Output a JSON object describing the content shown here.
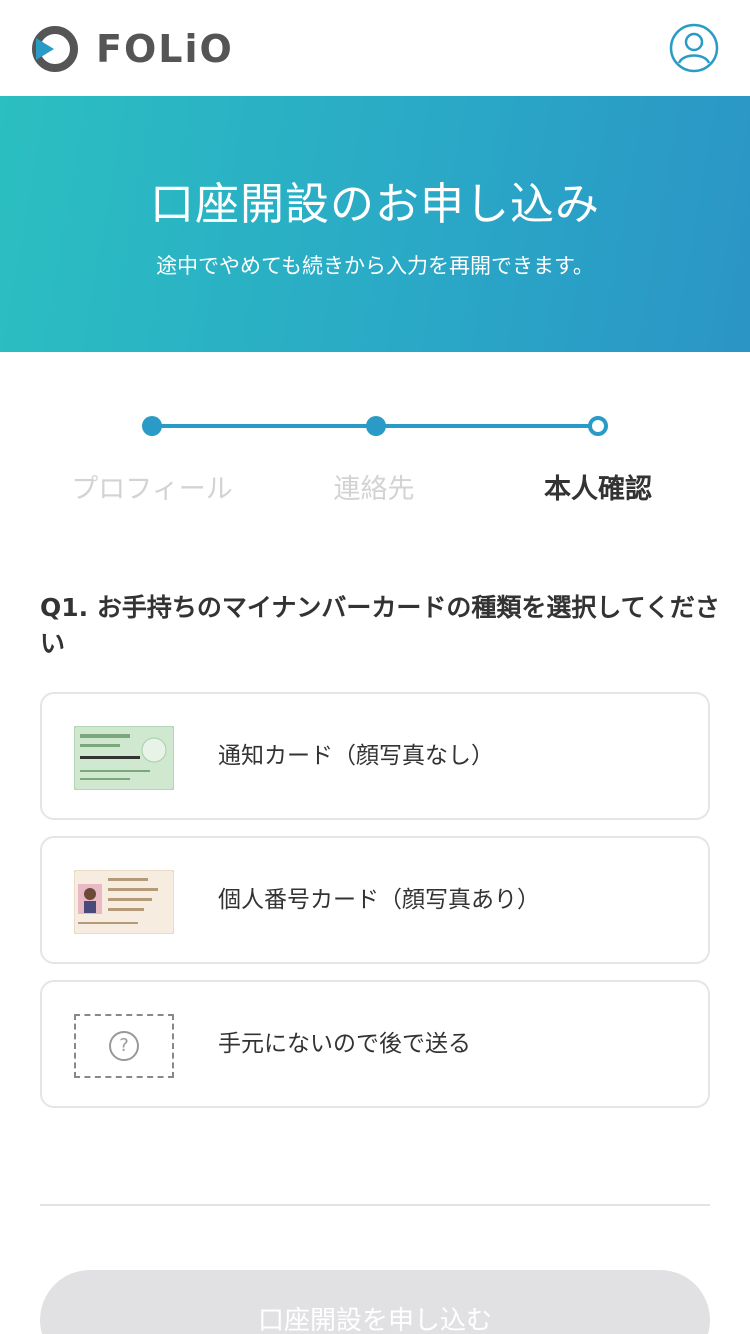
{
  "header": {
    "logo_text": "FOLiO",
    "logo_icon": "folio-logo-icon",
    "user_icon": "user-account-icon"
  },
  "hero": {
    "title": "口座開設のお申し込み",
    "subtitle": "途中でやめても続きから入力を再開できます。"
  },
  "steps": [
    {
      "label": "プロフィール",
      "state": "done"
    },
    {
      "label": "連絡先",
      "state": "done"
    },
    {
      "label": "本人確認",
      "state": "current"
    }
  ],
  "question": {
    "text": "Q1. お手持ちのマイナンバーカードの種類を選択してください"
  },
  "options": [
    {
      "label": "通知カード（顔写真なし）",
      "icon": "notification-card-icon"
    },
    {
      "label": "個人番号カード（顔写真あり）",
      "icon": "my-number-card-icon"
    },
    {
      "label": "手元にないので後で送る",
      "icon": "question-icon",
      "icon_glyph": "?"
    }
  ],
  "submit": {
    "label": "口座開設を申し込む",
    "enabled": false
  },
  "colors": {
    "accent": "#2a9bc6",
    "hero_start": "#2bbfc1",
    "hero_end": "#2b95c6",
    "disabled_button": "#e1e1e3"
  }
}
